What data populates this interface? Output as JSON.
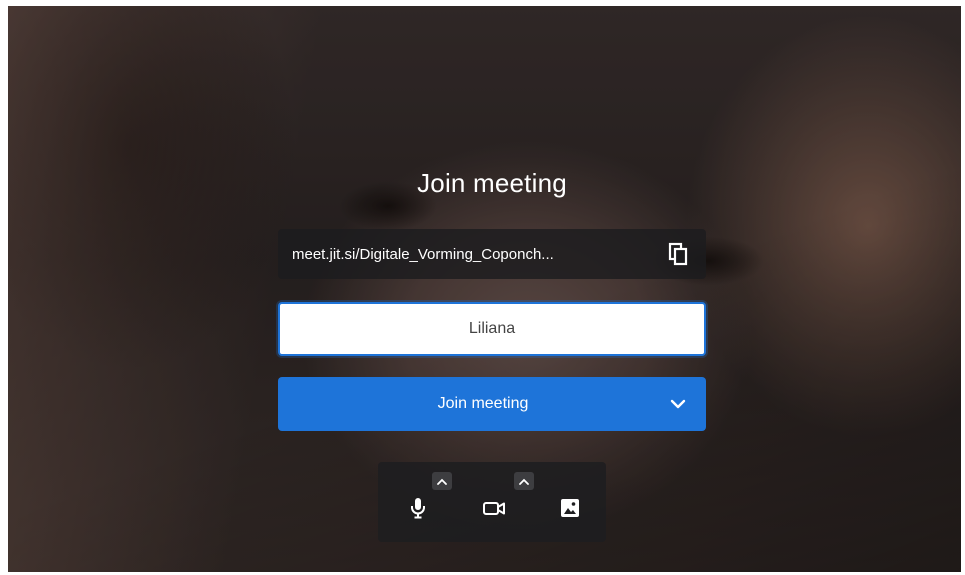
{
  "prejoin": {
    "title": "Join meeting",
    "meeting_url": "meet.jit.si/Digitale_Vorming_Coponch...",
    "name_value": "Liliana",
    "join_button_label": "Join meeting"
  },
  "icons": {
    "copy": "copy-icon",
    "join_options": "chevron-down-icon",
    "microphone": "microphone-icon",
    "microphone_options": "chevron-up-icon",
    "camera": "camera-icon",
    "camera_options": "chevron-up-icon",
    "background": "image-icon"
  },
  "colors": {
    "accent": "#1e74d9",
    "toolbar_bg": "#1e1e20",
    "text_light": "#ffffff"
  }
}
